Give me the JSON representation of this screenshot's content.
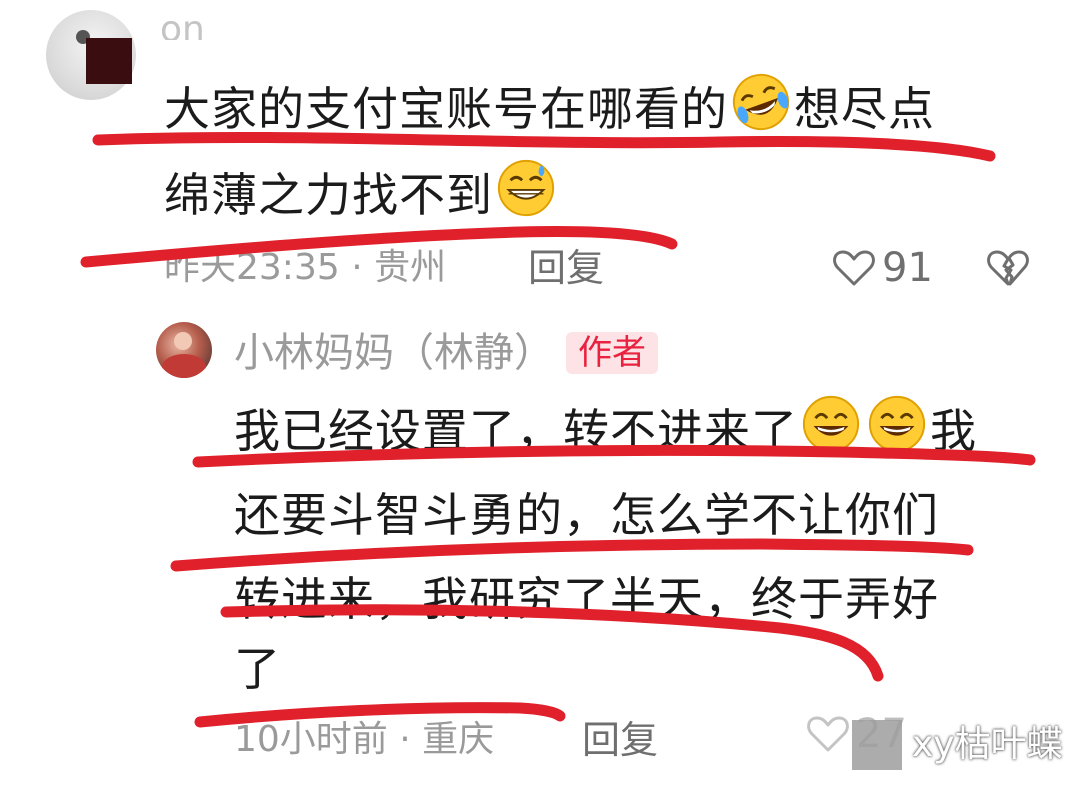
{
  "top_comment": {
    "username_partial": "on",
    "text_line1": "大家的支付宝账号在哪看的",
    "text_line1_after": "想尽点",
    "text_line2": "绵薄之力找不到",
    "meta": "昨天23:35 · 贵州",
    "reply_label": "回复",
    "like_count": "91",
    "emojis": [
      "rolling-laughing-emoji",
      "grinning-sweat-emoji"
    ]
  },
  "author_reply": {
    "username": "小林妈妈（林静）",
    "badge": "作者",
    "text_line1": "我已经设置了，转不进来了",
    "text_line1_after": "我",
    "text_line2": "还要斗智斗勇的，怎么学不让你们",
    "text_line3": "转进来，我研究了半天，终于弄好",
    "text_line4": "了",
    "meta": "10小时前 · 重庆",
    "reply_label": "回复",
    "like_count_partial": "27",
    "emojis": [
      "grinning-emoji",
      "grinning-emoji"
    ]
  },
  "watermark": {
    "text": "xy枯叶蝶"
  },
  "colors": {
    "annotation_red": "#e0212c",
    "text_main": "#1b1b1b",
    "text_meta": "#9a9a9a",
    "badge_bg": "#fde3e6",
    "badge_text": "#e8223f"
  }
}
